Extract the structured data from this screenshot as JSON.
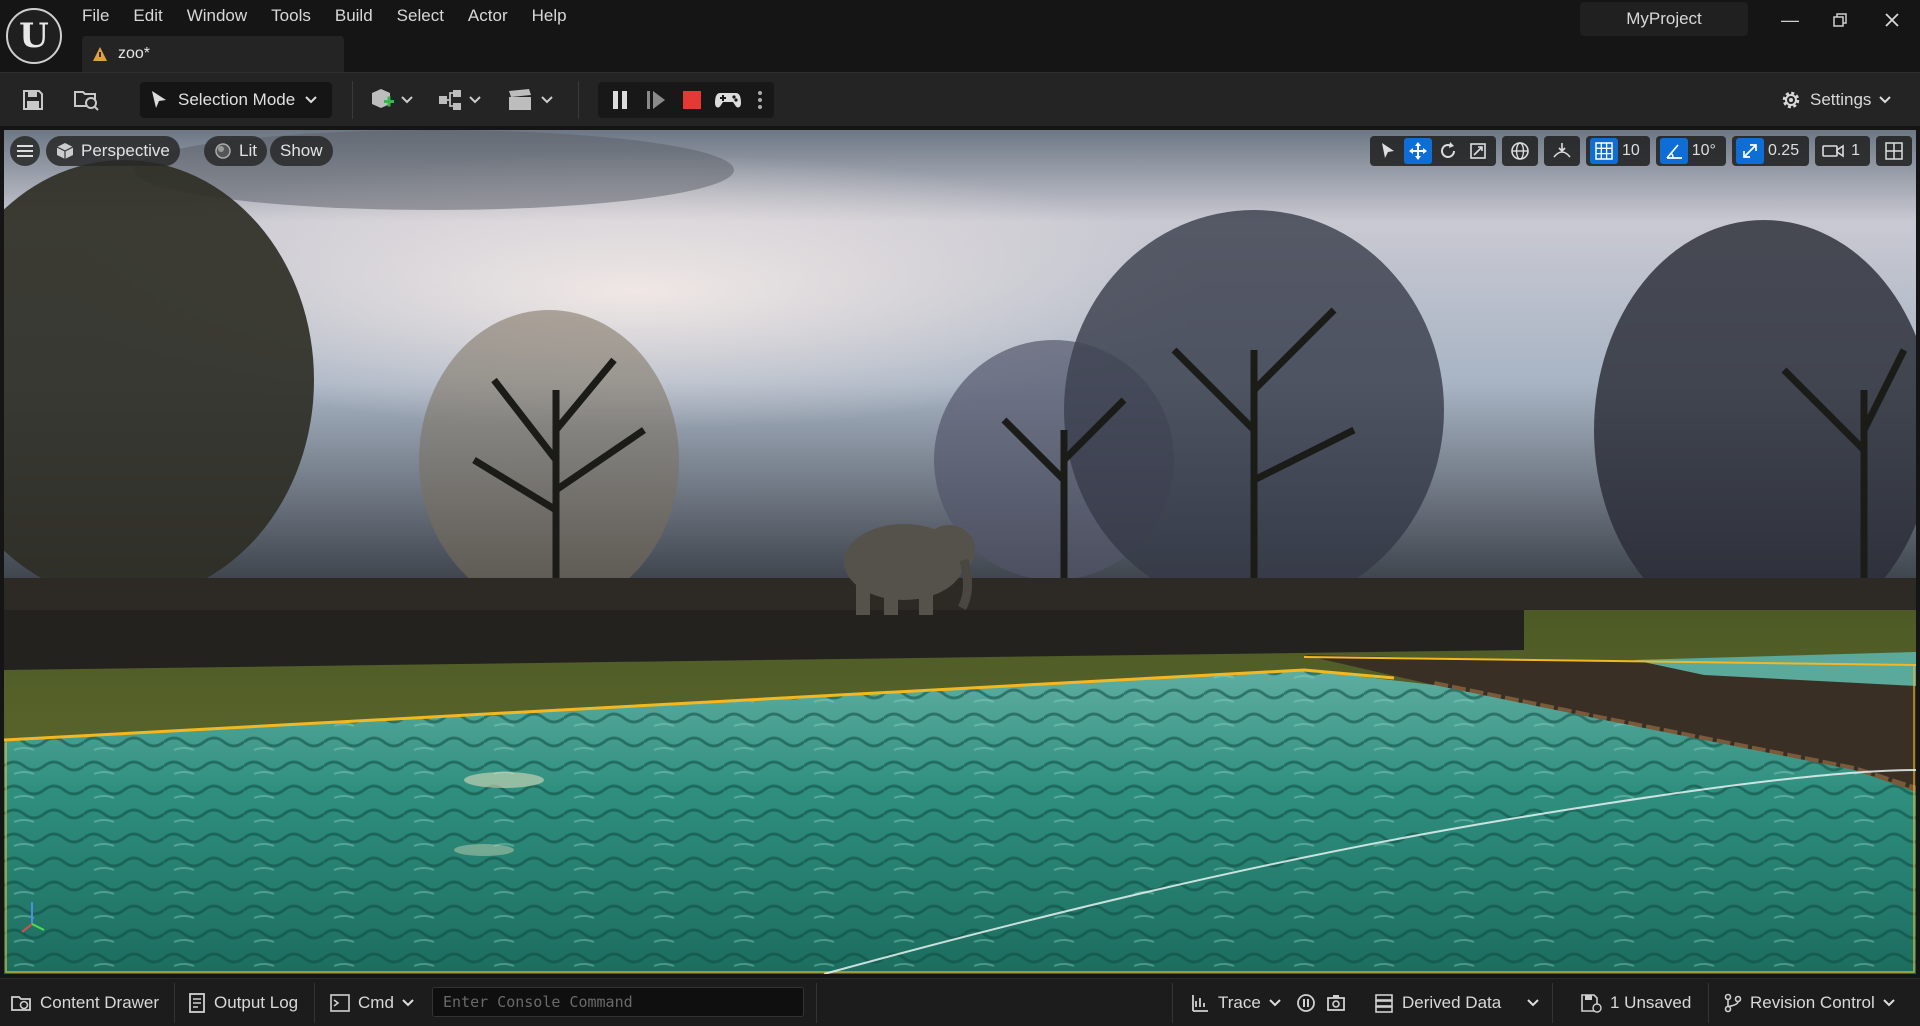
{
  "menu": [
    "File",
    "Edit",
    "Window",
    "Tools",
    "Build",
    "Select",
    "Actor",
    "Help"
  ],
  "level_tab": {
    "label": "zoo*"
  },
  "project": {
    "name": "MyProject"
  },
  "toolbar": {
    "selection_mode": "Selection Mode",
    "settings": "Settings"
  },
  "viewport": {
    "view_mode": "Perspective",
    "lighting": "Lit",
    "show": "Show",
    "grid_snap": "10",
    "rotation_snap": "10°",
    "scale_snap": "0.25",
    "camera_speed": "1"
  },
  "statusbar": {
    "content_drawer": "Content Drawer",
    "output_log": "Output Log",
    "cmd": "Cmd",
    "console_placeholder": "Enter Console Command",
    "trace": "Trace",
    "derived_data": "Derived Data",
    "unsaved": "1 Unsaved",
    "revision_control": "Revision Control"
  },
  "colors": {
    "accent_blue": "#0e6ed6",
    "stop_red": "#e53935",
    "selection_outline": "#f2b824",
    "water": "#2f8f7f",
    "grass": "#5d6a2c"
  }
}
